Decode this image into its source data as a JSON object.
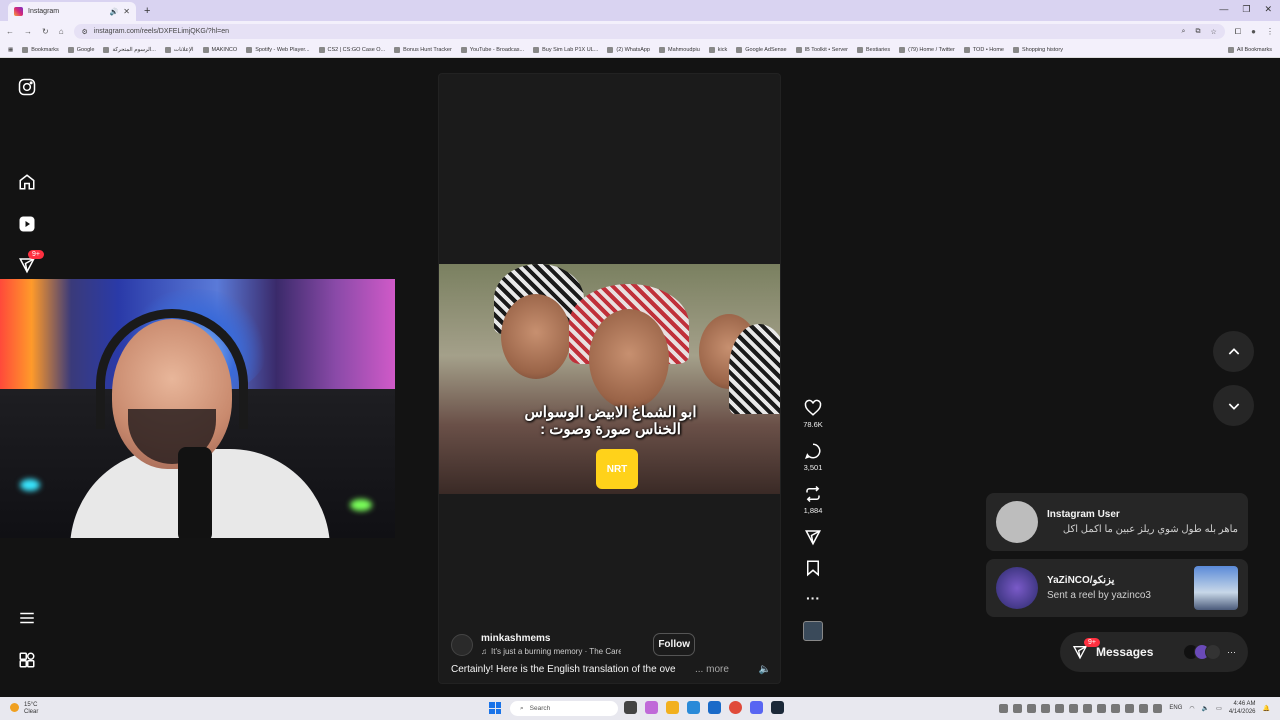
{
  "browser": {
    "tab_title": "Instagram",
    "url": "instagram.com/reels/DXFELimjQKG/?hl=en",
    "bookmarks": [
      "Bookmarks",
      "Google",
      "الرسوم المتحركة...",
      "الإعلانات",
      "MAKINCO",
      "Spotify - Web Player...",
      "CS2 | CS:GO Case O...",
      "Bonus Hunt Tracker",
      "YouTube - Broadcas...",
      "Buy Sim Lab P1X UL...",
      "(2) WhatsApp",
      "Mahmoudpiu",
      "kick",
      "Google AdSense",
      "IB Toolkit • Server",
      "Bestiaries",
      "(79) Home / Twitter",
      "TOD • Home",
      "Shopping history"
    ],
    "all_bookmarks": "All Bookmarks"
  },
  "sidebar": {
    "notification_badge": "9+"
  },
  "reel": {
    "overlay_line1": "ابو الشماغ الابيض الوسواس",
    "overlay_line2": "الخناس صورة وصوت :",
    "mic_label": "NRT",
    "author": "minkashmems",
    "audio": "It's just a burning memory · The Caretaker",
    "follow_label": "Follow",
    "caption": "Certainly! Here is the English translation of the ove",
    "more_label": "... more"
  },
  "actions": {
    "likes": "78.6K",
    "comments": "3,501",
    "reposts": "1,884"
  },
  "notifications": [
    {
      "title": "Instagram User",
      "text": "ماهر بله طول شوي ريلز عبين ما اكمل اكل"
    },
    {
      "title": "YaZiNCO/يزنكو",
      "text": "Sent a reel by yazinco3"
    }
  ],
  "messages": {
    "label": "Messages",
    "badge": "9+"
  },
  "taskbar": {
    "temperature": "15°C",
    "condition": "Clear",
    "search_placeholder": "Search",
    "lang": "ENG",
    "time": "4:46 AM",
    "date": "4/14/2026"
  },
  "colors": {
    "badge_red": "#ff3040",
    "bg": "#121212",
    "panel": "#262626"
  }
}
